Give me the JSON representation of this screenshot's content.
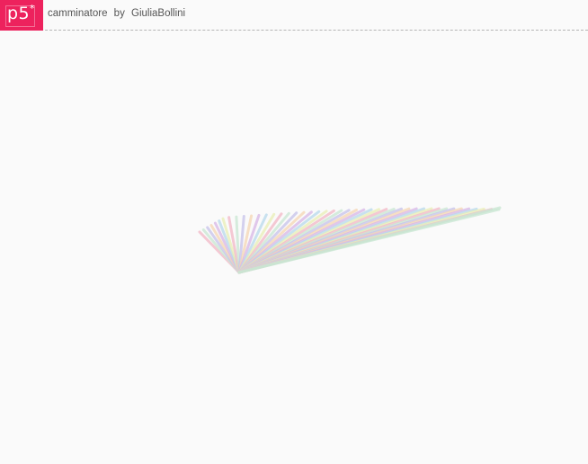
{
  "header": {
    "logo_text": "p5",
    "logo_superscript": "*",
    "sketch_title": "camminatore",
    "by_label": "by",
    "author": "GiuliaBollini",
    "logo_color": "#ed225d"
  },
  "sketch": {
    "background_color": "#fafafa",
    "line_colors": [
      "#f2b8c6",
      "#c9e7d3",
      "#c7c2ea",
      "#f5d6b4",
      "#d8b7e6",
      "#b8d9ec",
      "#e9efb5"
    ],
    "line_opacity": 0.75
  }
}
